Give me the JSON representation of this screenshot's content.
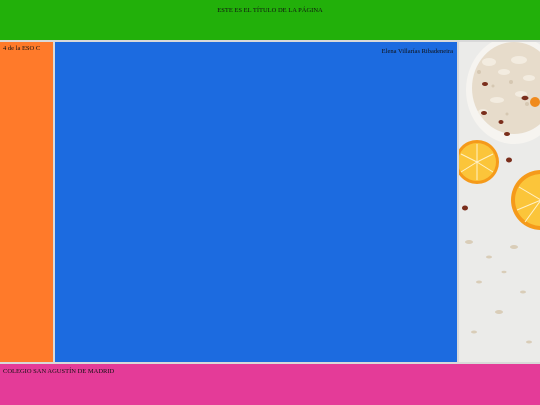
{
  "header": {
    "title": "ESTE ES EL TÍTULO DE LA PÁGINA"
  },
  "sidebar_left": {
    "label": "4 de la ESO C"
  },
  "main": {
    "author": "Elena Villarías Ribadeneira"
  },
  "sidebar_right": {
    "image": "oats-and-orange-slices-photo"
  },
  "footer": {
    "label": "COLEGIO SAN AGUSTÍN DE MADRID"
  },
  "colors": {
    "header": "#22b00a",
    "left": "#ff7a2a",
    "main": "#1c6be0",
    "footer": "#e43b98"
  }
}
